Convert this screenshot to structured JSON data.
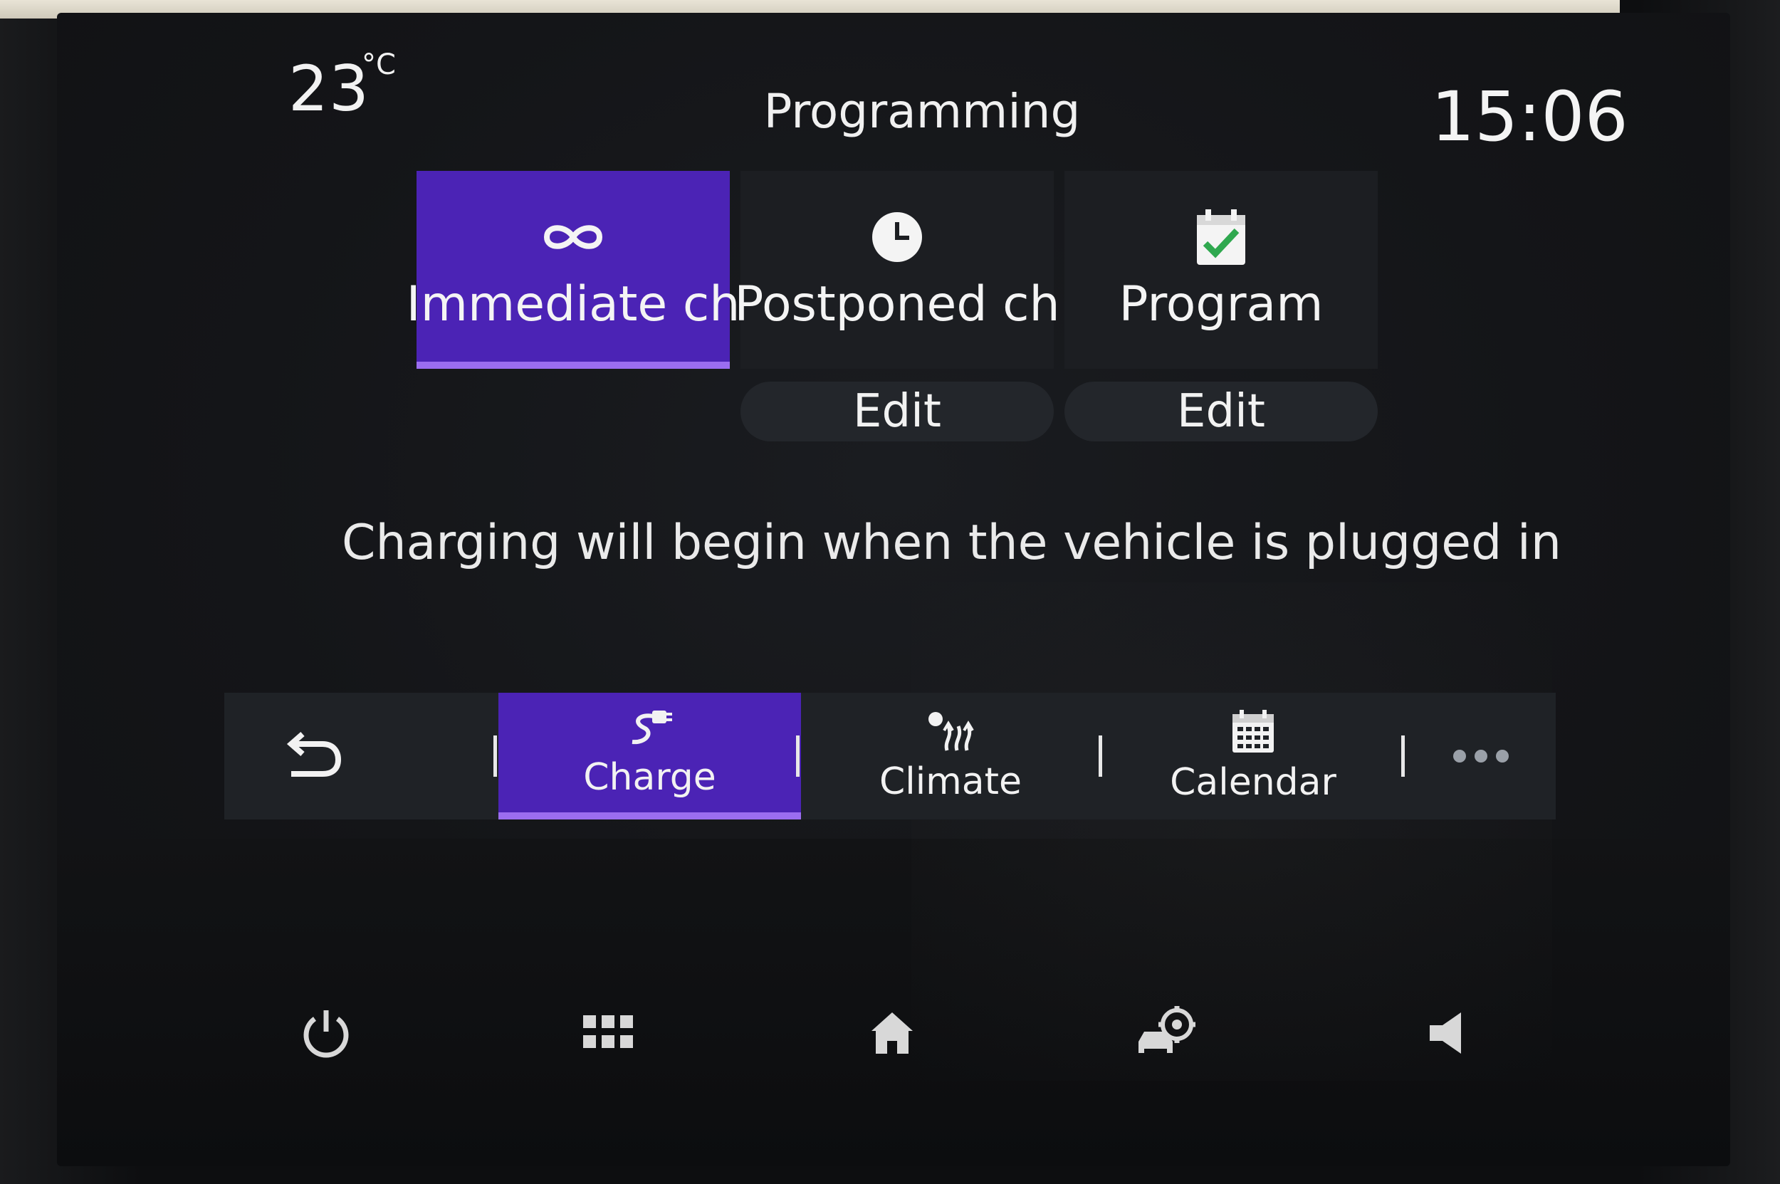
{
  "header": {
    "temperature": "23",
    "temperature_unit": "°C",
    "title": "Programming",
    "clock": "15:06"
  },
  "modes": [
    {
      "label": "Immediate ch",
      "icon": "infinity-icon",
      "active": true
    },
    {
      "label": "Postponed ch",
      "icon": "clock-icon",
      "active": false,
      "edit_label": "Edit"
    },
    {
      "label": "Program",
      "icon": "calendar-check-icon",
      "active": false,
      "edit_label": "Edit"
    }
  ],
  "message": "Charging will begin when the vehicle is plugged in",
  "tabbar": {
    "items": [
      {
        "label": "Charge",
        "icon": "charge-plug-icon",
        "active": true
      },
      {
        "label": "Climate",
        "icon": "climate-icon",
        "active": false
      },
      {
        "label": "Calendar",
        "icon": "calendar-icon",
        "active": false
      }
    ],
    "back_icon": "back-arrow-icon",
    "more_icon": "more-dots-icon"
  },
  "system_bar": [
    "power-icon",
    "apps-grid-icon",
    "home-icon",
    "car-settings-icon",
    "volume-icon"
  ],
  "colors": {
    "accent": "#4b23b5",
    "accent_underline": "#9b6df0",
    "check_green": "#2fa84f"
  }
}
